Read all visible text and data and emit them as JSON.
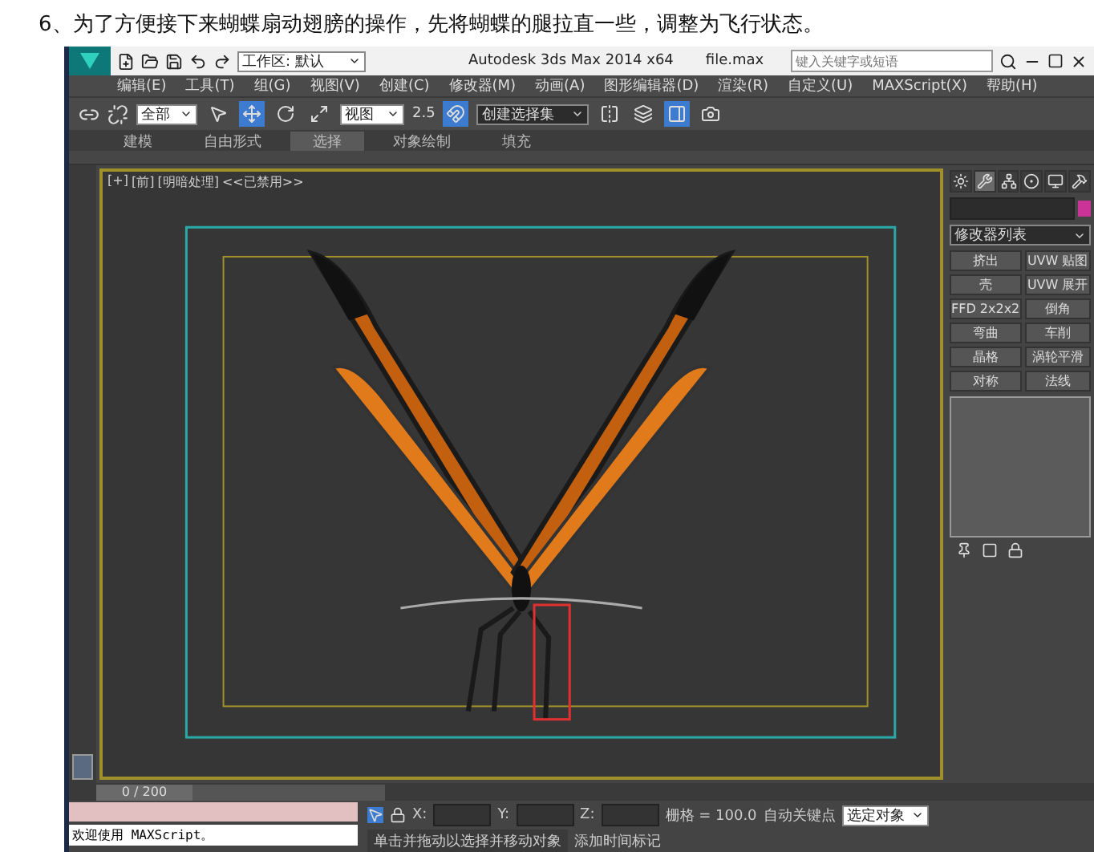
{
  "caption": "6、为了方便接下来蝴蝶扇动翅膀的操作，先将蝴蝶的腿拉直一些，调整为飞行状态。",
  "window": {
    "workspace": "工作区: 默认",
    "title": "Autodesk 3ds Max  2014 x64",
    "file": "file.max",
    "search": {
      "placeholder": "键入关键字或短语"
    }
  },
  "menu": [
    "编辑(E)",
    "工具(T)",
    "组(G)",
    "视图(V)",
    "创建(C)",
    "修改器(M)",
    "动画(A)",
    "图形编辑器(D)",
    "渲染(R)",
    "自定义(U)",
    "MAXScript(X)",
    "帮助(H)"
  ],
  "toolbar": {
    "selection_filter": "全部",
    "reference_coord": "视图",
    "snap_value": "2.5",
    "named_selection": "创建选择集",
    "tools": [
      {
        "kind": "select",
        "active": false
      },
      {
        "kind": "move",
        "active": true
      },
      {
        "kind": "rotate",
        "active": false
      },
      {
        "kind": "scale",
        "active": false
      },
      {
        "kind": "snap",
        "active": true
      },
      {
        "kind": "mirror",
        "active": false
      },
      {
        "kind": "layers",
        "active": false
      },
      {
        "kind": "panel",
        "active": true
      },
      {
        "kind": "render",
        "active": false
      }
    ]
  },
  "ribbon_tabs": [
    {
      "label": "建模",
      "selected": false
    },
    {
      "label": "自由形式",
      "selected": false
    },
    {
      "label": "选择",
      "selected": true
    },
    {
      "label": "对象绘制",
      "selected": false
    },
    {
      "label": "填充",
      "selected": false
    }
  ],
  "viewport": {
    "labels": [
      "[+]",
      "[前]",
      "[明暗处理]",
      "<<已禁用>>"
    ]
  },
  "command_panel": {
    "tabs": [
      {
        "kind": "create",
        "selected": false
      },
      {
        "kind": "modify",
        "selected": true
      },
      {
        "kind": "hierarchy",
        "selected": false
      },
      {
        "kind": "motion",
        "selected": false
      },
      {
        "kind": "display",
        "selected": false
      },
      {
        "kind": "utilities",
        "selected": false
      }
    ],
    "modifier_list": "修改器列表",
    "modifiers": [
      "挤出",
      "UVW 贴图",
      "壳",
      "UVW 展开",
      "FFD 2x2x2",
      "倒角",
      "弯曲",
      "车削",
      "晶格",
      "涡轮平滑",
      "对称",
      "法线"
    ]
  },
  "timeline": {
    "position": "0 / 200"
  },
  "status": {
    "listener_output": "欢迎使用 MAXScript。",
    "prompt": "单击并拖动以选择并移动对象",
    "coords": [
      "X:",
      "Y:",
      "Z:"
    ],
    "grid": "栅格 = 100.0",
    "auto_key": "自动关键点",
    "selection_set": "选定对象",
    "add_time_tag": "添加时间标记"
  }
}
